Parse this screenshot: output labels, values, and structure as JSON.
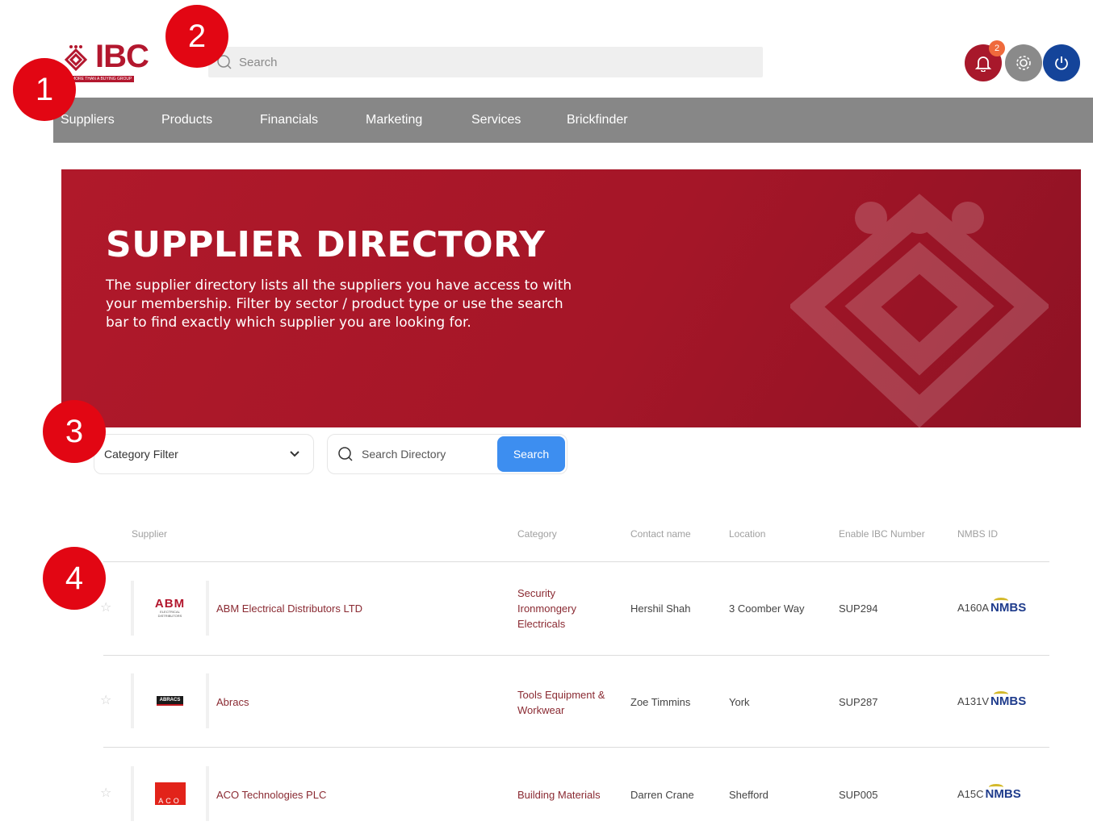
{
  "logo": {
    "text": "IBC",
    "tagline": "MORE THAN A BUYING GROUP"
  },
  "search": {
    "placeholder": "Search"
  },
  "header_icons": {
    "notifications_count": "2"
  },
  "nav": [
    "Suppliers",
    "Products",
    "Financials",
    "Marketing",
    "Services",
    "Brickfinder"
  ],
  "callouts": [
    "1",
    "2",
    "3",
    "4"
  ],
  "hero": {
    "title": "SUPPLIER DIRECTORY",
    "description": "The supplier directory lists all the suppliers you have access to with your membership. Filter by sector / product type or use the search bar to find exactly which supplier you are looking for."
  },
  "filters": {
    "category_label": "Category Filter",
    "search_placeholder": "Search Directory",
    "search_button": "Search"
  },
  "table": {
    "headers": [
      "Supplier",
      "Category",
      "Contact name",
      "Location",
      "Enable IBC Number",
      "NMBS ID"
    ],
    "rows": [
      {
        "logo_text": "ABM",
        "logo_sub": "ELECTRICAL DISTRIBUTORS",
        "name": "ABM Electrical Distributors LTD",
        "category": [
          "Security",
          "Ironmongery",
          "Electricals"
        ],
        "contact": "Hershil Shah",
        "location": "3 Coomber Way",
        "ibc": "SUP294",
        "nmbs_id": "A160A",
        "nmbs_logo": "NMBS"
      },
      {
        "logo_text": "ABRACS",
        "name": "Abracs",
        "category": [
          "Tools Equipment &",
          "Workwear"
        ],
        "contact": "Zoe Timmins",
        "location": "York",
        "ibc": "SUP287",
        "nmbs_id": "A131V",
        "nmbs_logo": "NMBS"
      },
      {
        "logo_text": "ACO",
        "name": "ACO Technologies PLC",
        "category": [
          "Building Materials"
        ],
        "contact": "Darren Crane",
        "location": "Shefford",
        "ibc": "SUP005",
        "nmbs_id": "A15C",
        "nmbs_logo": "NMBS"
      }
    ]
  },
  "colors": {
    "brand_red": "#b3172e",
    "nav_grey": "#878787",
    "button_blue": "#3d8ef0",
    "callout_red": "#e20613"
  }
}
